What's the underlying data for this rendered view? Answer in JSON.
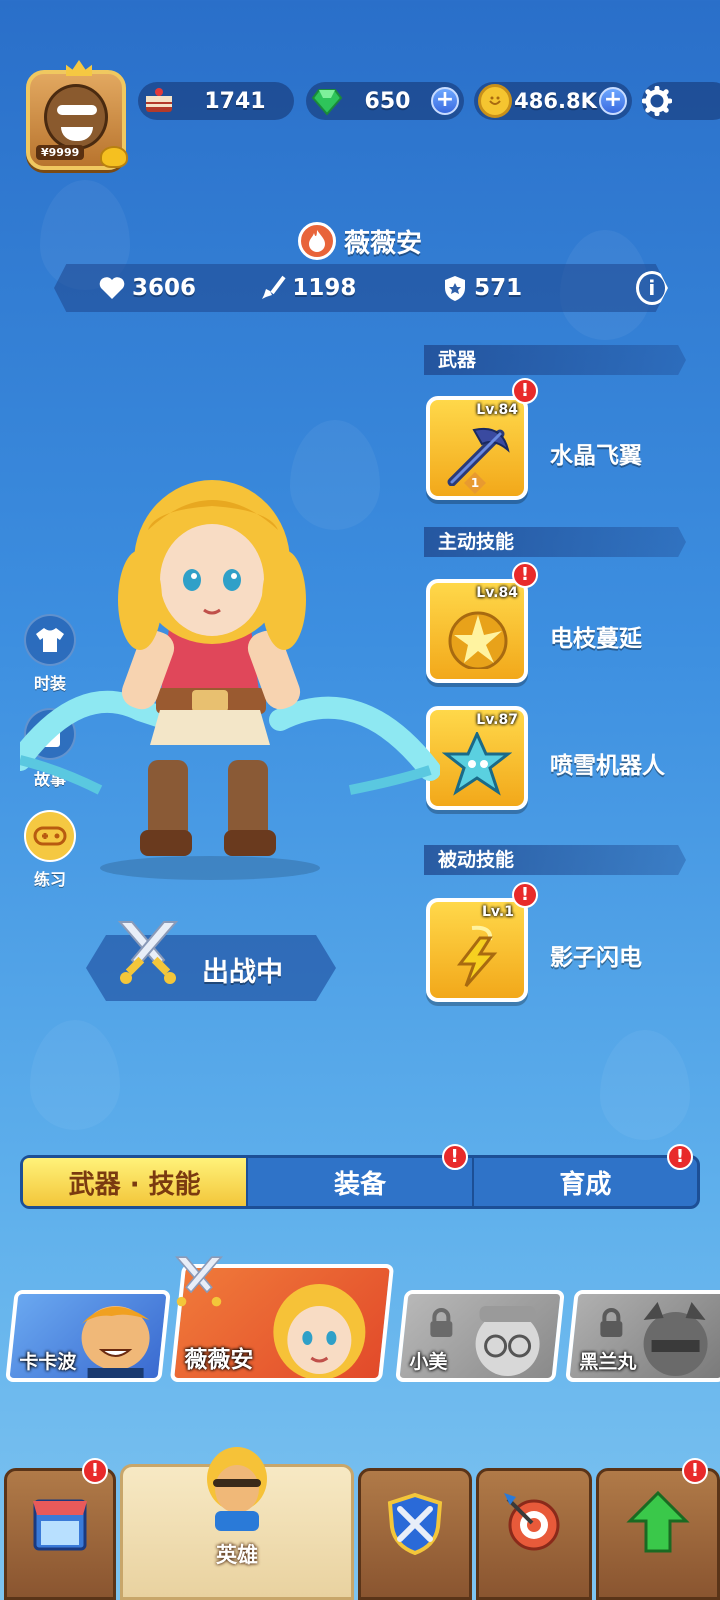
{
  "top_bar": {
    "avatar_tag": "¥9999",
    "resources": [
      {
        "name": "cake",
        "value": "1741",
        "has_plus": false
      },
      {
        "name": "gem",
        "value": "650",
        "has_plus": true
      },
      {
        "name": "coin",
        "value": "486.8K",
        "has_plus": true
      }
    ]
  },
  "hero": {
    "name": "薇薇安",
    "stats": {
      "hp": "3606",
      "attack": "1198",
      "defense": "571"
    }
  },
  "sections": {
    "weapon": {
      "header": "武器",
      "item": {
        "level": "Lv.84",
        "name": "水晶飞翼",
        "badge": "1",
        "alert": "!"
      }
    },
    "active": {
      "header": "主动技能",
      "items": [
        {
          "level": "Lv.84",
          "name": "电枝蔓延",
          "alert": "!"
        },
        {
          "level": "Lv.87",
          "name": "喷雪机器人",
          "alert": ""
        }
      ]
    },
    "passive": {
      "header": "被动技能",
      "item": {
        "level": "Lv.1",
        "name": "影子闪电",
        "alert": "!"
      }
    }
  },
  "side_buttons": [
    {
      "label": "时装",
      "icon": "shirt-icon"
    },
    {
      "label": "故事",
      "icon": "story-icon"
    },
    {
      "label": "练习",
      "icon": "gamepad-icon"
    }
  ],
  "battle_status": "出战中",
  "tabs": [
    {
      "label": "武器 · 技能",
      "active": true,
      "alert": ""
    },
    {
      "label": "装备",
      "active": false,
      "alert": "!"
    },
    {
      "label": "育成",
      "active": false,
      "alert": "!"
    }
  ],
  "hero_roster": [
    {
      "name": "卡卡波",
      "locked": false,
      "selected": false
    },
    {
      "name": "薇薇安",
      "locked": false,
      "selected": true
    },
    {
      "name": "小美",
      "locked": true,
      "selected": false
    },
    {
      "name": "黑兰丸",
      "locked": true,
      "selected": false
    }
  ],
  "bottom_nav": {
    "active_label": "英雄",
    "alerts": [
      "!",
      "!"
    ]
  },
  "colors": {
    "accent_yellow": "#f3c63a",
    "alert_red": "#e82a2a",
    "bg_blue": "#3d8fe0"
  }
}
